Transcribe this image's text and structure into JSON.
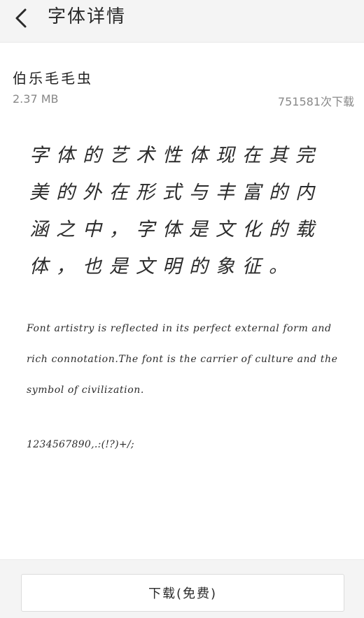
{
  "header": {
    "title": "字体详情"
  },
  "font": {
    "name": "伯乐毛毛虫",
    "size": "2.37 MB",
    "downloads": "751581次下载"
  },
  "preview": {
    "chinese_text": "字体的艺术性体现在其完美的外在形式与丰富的内涵之中，字体是文化的载体，也是文明的象征。",
    "english_text": "Font artistry is reflected in its perfect external form and rich connotation.The font is the carrier of culture and the symbol of civilization.",
    "digits_text": "1234567890,.:(!?)+/;"
  },
  "footer": {
    "download_label": "下载(免费)"
  }
}
